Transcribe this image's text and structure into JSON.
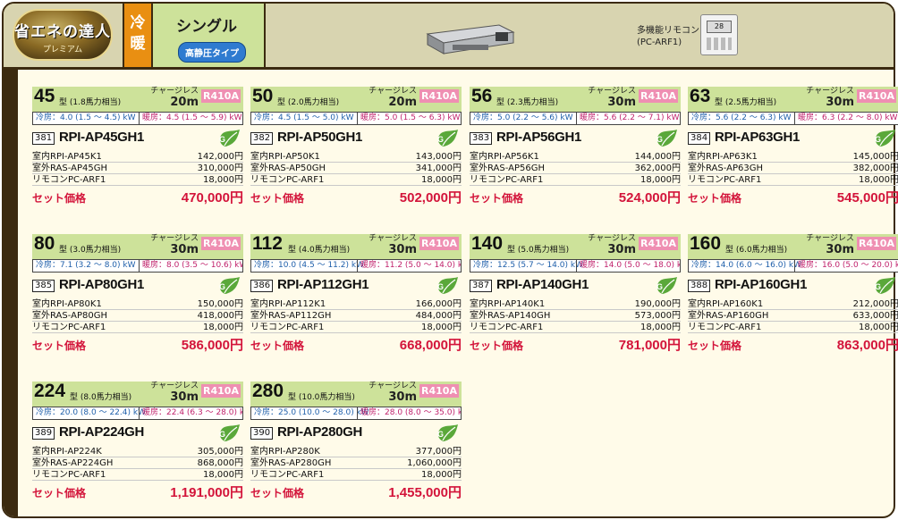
{
  "header": {
    "logo_line1": "省エネの達人",
    "logo_line2": "プレミアム",
    "mode": "冷暖",
    "type": "シングル",
    "badge": "高静圧タイプ",
    "remote_label": "多機能リモコン",
    "remote_model": "(PC-ARF1)",
    "remote_screen": "28"
  },
  "common": {
    "charge_label": "チャージレス",
    "refrigerant": "R410A",
    "set_label": "セット価格"
  },
  "products": [
    {
      "size": "45",
      "sub": "型 (1.8馬力相当)",
      "charge": "20m",
      "cool": "冷房：4.0 (1.5 ～ 4.5) kW",
      "heat": "暖房：4.5 (1.5 ～ 5.9) kW",
      "no": "381",
      "model": "RPI-AP45GH1",
      "parts": [
        {
          "name": "室内RPI-AP45K1",
          "price": "142,000円"
        },
        {
          "name": "室外RAS-AP45GH",
          "price": "310,000円"
        },
        {
          "name": "リモコンPC-ARF1",
          "price": "18,000円"
        }
      ],
      "total": "470,000円"
    },
    {
      "size": "50",
      "sub": "型 (2.0馬力相当)",
      "charge": "20m",
      "cool": "冷房：4.5 (1.5 ～ 5.0) kW",
      "heat": "暖房：5.0 (1.5 ～ 6.3) kW",
      "no": "382",
      "model": "RPI-AP50GH1",
      "parts": [
        {
          "name": "室内RPI-AP50K1",
          "price": "143,000円"
        },
        {
          "name": "室外RAS-AP50GH",
          "price": "341,000円"
        },
        {
          "name": "リモコンPC-ARF1",
          "price": "18,000円"
        }
      ],
      "total": "502,000円"
    },
    {
      "size": "56",
      "sub": "型 (2.3馬力相当)",
      "charge": "30m",
      "cool": "冷房：5.0 (2.2 ～ 5.6) kW",
      "heat": "暖房：5.6 (2.2 ～ 7.1) kW",
      "no": "383",
      "model": "RPI-AP56GH1",
      "parts": [
        {
          "name": "室内RPI-AP56K1",
          "price": "144,000円"
        },
        {
          "name": "室外RAS-AP56GH",
          "price": "362,000円"
        },
        {
          "name": "リモコンPC-ARF1",
          "price": "18,000円"
        }
      ],
      "total": "524,000円"
    },
    {
      "size": "63",
      "sub": "型 (2.5馬力相当)",
      "charge": "30m",
      "cool": "冷房：5.6 (2.2 ～ 6.3) kW",
      "heat": "暖房：6.3 (2.2 ～ 8.0) kW",
      "no": "384",
      "model": "RPI-AP63GH1",
      "parts": [
        {
          "name": "室内RPI-AP63K1",
          "price": "145,000円"
        },
        {
          "name": "室外RAS-AP63GH",
          "price": "382,000円"
        },
        {
          "name": "リモコンPC-ARF1",
          "price": "18,000円"
        }
      ],
      "total": "545,000円"
    },
    {
      "size": "80",
      "sub": "型 (3.0馬力相当)",
      "charge": "30m",
      "cool": "冷房：7.1 (3.2 ～ 8.0) kW",
      "heat": "暖房：8.0 (3.5 ～ 10.6) kW",
      "no": "385",
      "model": "RPI-AP80GH1",
      "parts": [
        {
          "name": "室内RPI-AP80K1",
          "price": "150,000円"
        },
        {
          "name": "室外RAS-AP80GH",
          "price": "418,000円"
        },
        {
          "name": "リモコンPC-ARF1",
          "price": "18,000円"
        }
      ],
      "total": "586,000円"
    },
    {
      "size": "112",
      "sub": "型 (4.0馬力相当)",
      "charge": "30m",
      "cool": "冷房：10.0 (4.5 ～ 11.2) kW",
      "heat": "暖房：11.2 (5.0 ～ 14.0) kW",
      "no": "386",
      "model": "RPI-AP112GH1",
      "parts": [
        {
          "name": "室内RPI-AP112K1",
          "price": "166,000円"
        },
        {
          "name": "室外RAS-AP112GH",
          "price": "484,000円"
        },
        {
          "name": "リモコンPC-ARF1",
          "price": "18,000円"
        }
      ],
      "total": "668,000円"
    },
    {
      "size": "140",
      "sub": "型 (5.0馬力相当)",
      "charge": "30m",
      "cool": "冷房：12.5 (5.7 ～ 14.0) kW",
      "heat": "暖房：14.0 (5.0 ～ 18.0) kW",
      "no": "387",
      "model": "RPI-AP140GH1",
      "parts": [
        {
          "name": "室内RPI-AP140K1",
          "price": "190,000円"
        },
        {
          "name": "室外RAS-AP140GH",
          "price": "573,000円"
        },
        {
          "name": "リモコンPC-ARF1",
          "price": "18,000円"
        }
      ],
      "total": "781,000円"
    },
    {
      "size": "160",
      "sub": "型 (6.0馬力相当)",
      "charge": "30m",
      "cool": "冷房：14.0 (6.0 ～ 16.0) kW",
      "heat": "暖房：16.0 (5.0 ～ 20.0) kW",
      "no": "388",
      "model": "RPI-AP160GH1",
      "parts": [
        {
          "name": "室内RPI-AP160K1",
          "price": "212,000円"
        },
        {
          "name": "室外RAS-AP160GH",
          "price": "633,000円"
        },
        {
          "name": "リモコンPC-ARF1",
          "price": "18,000円"
        }
      ],
      "total": "863,000円"
    },
    {
      "size": "224",
      "sub": "型 (8.0馬力相当)",
      "charge": "30m",
      "cool": "冷房：20.0 (8.0 ～ 22.4) kW",
      "heat": "暖房：22.4 (6.3 ～ 28.0) kW",
      "no": "389",
      "model": "RPI-AP224GH",
      "parts": [
        {
          "name": "室内RPI-AP224K",
          "price": "305,000円"
        },
        {
          "name": "室外RAS-AP224GH",
          "price": "868,000円"
        },
        {
          "name": "リモコンPC-ARF1",
          "price": "18,000円"
        }
      ],
      "total": "1,191,000円"
    },
    {
      "size": "280",
      "sub": "型 (10.0馬力相当)",
      "charge": "30m",
      "cool": "冷房：25.0 (10.0 ～ 28.0) kW",
      "heat": "暖房：28.0 (8.0 ～ 35.0) kW",
      "no": "390",
      "model": "RPI-AP280GH",
      "parts": [
        {
          "name": "室内RPI-AP280K",
          "price": "377,000円"
        },
        {
          "name": "室外RAS-AP280GH",
          "price": "1,060,000円"
        },
        {
          "name": "リモコンPC-ARF1",
          "price": "18,000円"
        }
      ],
      "total": "1,455,000円"
    }
  ]
}
